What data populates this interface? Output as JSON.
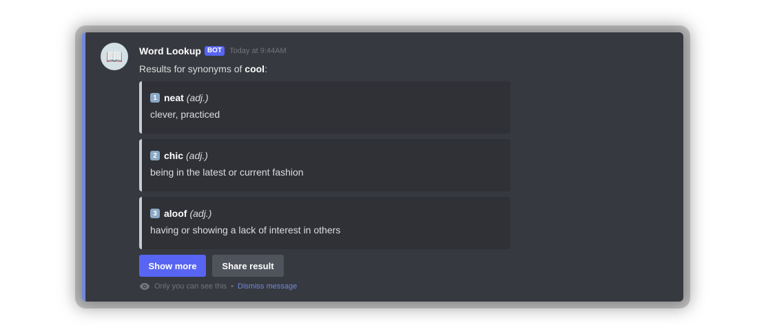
{
  "message": {
    "avatar_glyph": "📖",
    "username": "Word Lookup",
    "bot_tag": "BOT",
    "timestamp": "Today at 9:44AM",
    "intro_prefix": "Results for synonyms of ",
    "query": "cool",
    "intro_suffix": ":"
  },
  "results": [
    {
      "index": "1",
      "word": "neat",
      "pos": "(adj.)",
      "definition": "clever, practiced"
    },
    {
      "index": "2",
      "word": "chic",
      "pos": "(adj.)",
      "definition": "being in the latest or current fashion"
    },
    {
      "index": "3",
      "word": "aloof",
      "pos": "(adj.)",
      "definition": "having or showing a lack of interest in others"
    }
  ],
  "actions": {
    "show_more": "Show more",
    "share_result": "Share result"
  },
  "footer": {
    "visibility_note": "Only you can see this",
    "separator": "•",
    "dismiss": "Dismiss message"
  },
  "colors": {
    "accent": "#7289da",
    "primary_button": "#5865f2",
    "secondary_button": "#4f545c",
    "panel_bg": "#36393f",
    "card_bg": "#2f3136"
  }
}
